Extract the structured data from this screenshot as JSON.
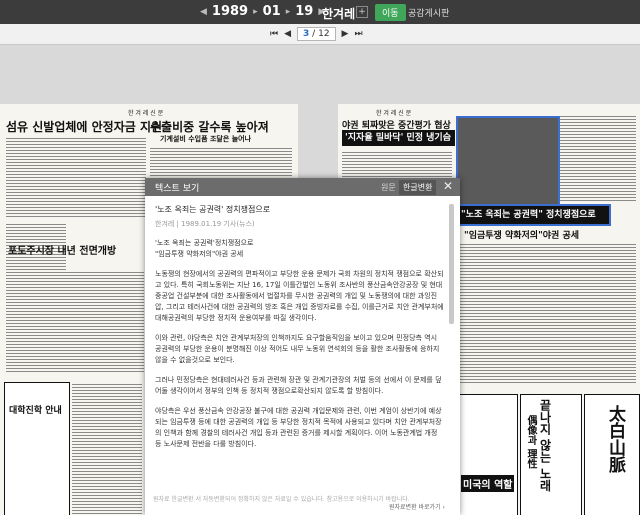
{
  "topbar": {
    "year": "1989",
    "month": "01",
    "day": "19",
    "newspaper": "한겨레",
    "go_label": "이동",
    "board_label": "공감게시판"
  },
  "pager": {
    "current": "3",
    "separator": "/",
    "total": "12"
  },
  "left_page": {
    "masthead": "한 겨 레 신 문",
    "headline_main": "섬유 신발업체에 안정자금 지원",
    "headline_2": "수출비중 갈수록 높아져",
    "sub_2": "기계설비 수입품 조달은 늘어나",
    "headline_3": "포도주시장 내년 전면개방",
    "box_title": "대학진학 안내"
  },
  "right_page": {
    "masthead": "한 겨 레 신 문",
    "headline_top": "야권 퇴짜맞은 중간평가 협상",
    "headline_box": "'지자율 밀바닥' 민정 냉기슴",
    "headline_big": "\"노조 옥죄는 공권력\" 정치쟁점으로",
    "sub_big": "\"임금투쟁 약화저의\"야권 공세",
    "ad_big": "太白山脈",
    "ad_2": "偶像과 理性",
    "ad_3": "끝나지 않는 노래",
    "ad_4": "미국의 역할"
  },
  "popup": {
    "header_title": "텍스트 보기",
    "tab_original": "원문",
    "tab_korean": "한글변환",
    "article_title": "'노조 옥죄는 공권력' 정치쟁점으로",
    "meta": "한겨레 | 1989.01.19 기사(뉴스)",
    "lead_1": "'노조 옥죄는 공권력'정치쟁점으로",
    "lead_2": "\"임금투쟁 약화저의\"야권 공세",
    "para_1": "노동쟁의 현장에서의 공권력의 편파적이고 부당한 운용 문제가 국회 차원의 정치적 쟁점으로 확산되고 있다. 특히 국회노동위는 지난 16, 17일 이틀간벌인 노동위 조사반의 풍산금속안강공장 및 현대중공업 건설부분에 대한 조사활동에서 법절차를 무시한 공권력의 개입 및 노동쟁의에 대한 과잉진압, 그리고 테러사건에 대한 공권력의 방조 혹은 개입 증빙자료를 수집, 이를근거로 치안 관계부처에 대해공권력의 부당한 정치적 운용여부를 따질 생각이다.",
    "para_2": "이와 관련, 야당측은 치안 관계부처장의 인책까지도 요구할움직임을 보이고 있으며 민정당측 역시 공권력의 부당한 운용이 분명해진 이상 적어도 내무 노동위 연석회의 등을 활한 조사활동에 응하지 않을 수 없을것으로 보인다.",
    "para_3": "그러나 민정당측은 현대테러사건 등과 관련해 장관 및 관계기관장의 처벌 등의 선에서 이 문제를 덮어둘 생각이어서 정부의 인책 등 정치적 쟁점으로확산되지 않도록 할 방침이다.",
    "para_4": "야당측은 우선 풍산금속 안강공장 불구에 대한 공권력 개입문제와 관련, 이번 계엄이 상반기에 예상되는 임금투쟁 등에 대한 공권력의 개입 등 부당한 정치적 목적에 사용되고 있다며 치안 관계부처장의 인책과 함께 경찰의 테러사건 개입 등과 관련된 증거를 제시할 계획이다. 이어 노동관계법 개정 등 노사문제 전반을 다룰 방침이다.",
    "footer_note": "원자료 한글변환 서 자동변환되어 정확하지 않은 자료일 수 있습니다. 참고용으로 이용하시기 바랍니다.",
    "footer_link": "원자료변환 바로가기 ›"
  }
}
